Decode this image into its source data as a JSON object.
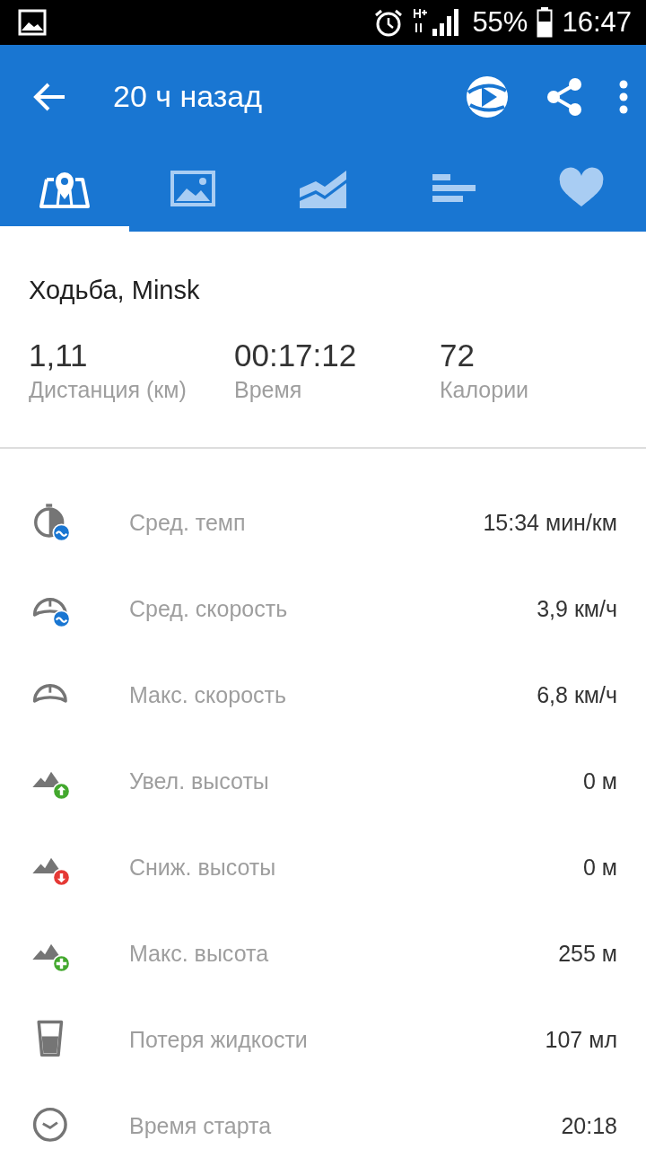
{
  "status_bar": {
    "battery": "55%",
    "time": "16:47"
  },
  "toolbar": {
    "title": "20 ч назад"
  },
  "tabs": [
    {
      "kind": "map",
      "selected": true
    },
    {
      "kind": "photos",
      "selected": false
    },
    {
      "kind": "chart",
      "selected": false
    },
    {
      "kind": "splits",
      "selected": false
    },
    {
      "kind": "heart",
      "selected": false
    }
  ],
  "activity": {
    "title": "Ходьба, Minsk"
  },
  "summary": [
    {
      "value": "1,11",
      "label": "Дистанция (км)"
    },
    {
      "value": "00:17:12",
      "label": "Время"
    },
    {
      "value": "72",
      "label": "Калории"
    }
  ],
  "stats": [
    {
      "kind": "pace",
      "label": "Сред. темп",
      "value": "15:34 мин/км"
    },
    {
      "kind": "avg-speed",
      "label": "Сред. скорость",
      "value": "3,9 км/ч"
    },
    {
      "kind": "max-speed",
      "label": "Макс. скорость",
      "value": "6,8 км/ч"
    },
    {
      "kind": "ascent",
      "label": "Увел. высоты",
      "value": "0 м"
    },
    {
      "kind": "descent",
      "label": "Сниж. высоты",
      "value": "0 м"
    },
    {
      "kind": "max-altitude",
      "label": "Макс. высота",
      "value": "255 м"
    },
    {
      "kind": "fluid",
      "label": "Потеря жидкости",
      "value": "107 мл"
    },
    {
      "kind": "start-time",
      "label": "Время старта",
      "value": "20:18"
    }
  ]
}
